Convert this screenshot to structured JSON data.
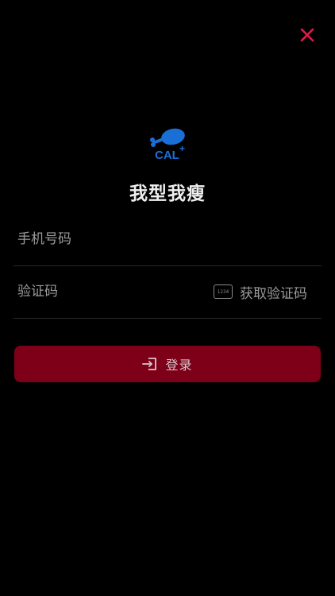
{
  "header": {
    "close_icon": "close-icon",
    "accent_color": "#e21a4a"
  },
  "logo": {
    "text": "CAL",
    "superscript": "+",
    "color": "#1a6fd6"
  },
  "title": "我型我瘦",
  "form": {
    "phone": {
      "value": "",
      "placeholder": "手机号码"
    },
    "code": {
      "value": "",
      "placeholder": "验证码",
      "chip_text": "1234",
      "get_code_label": "获取验证码"
    }
  },
  "login": {
    "label": "登录",
    "icon": "login-icon",
    "color": "#7d0018"
  }
}
